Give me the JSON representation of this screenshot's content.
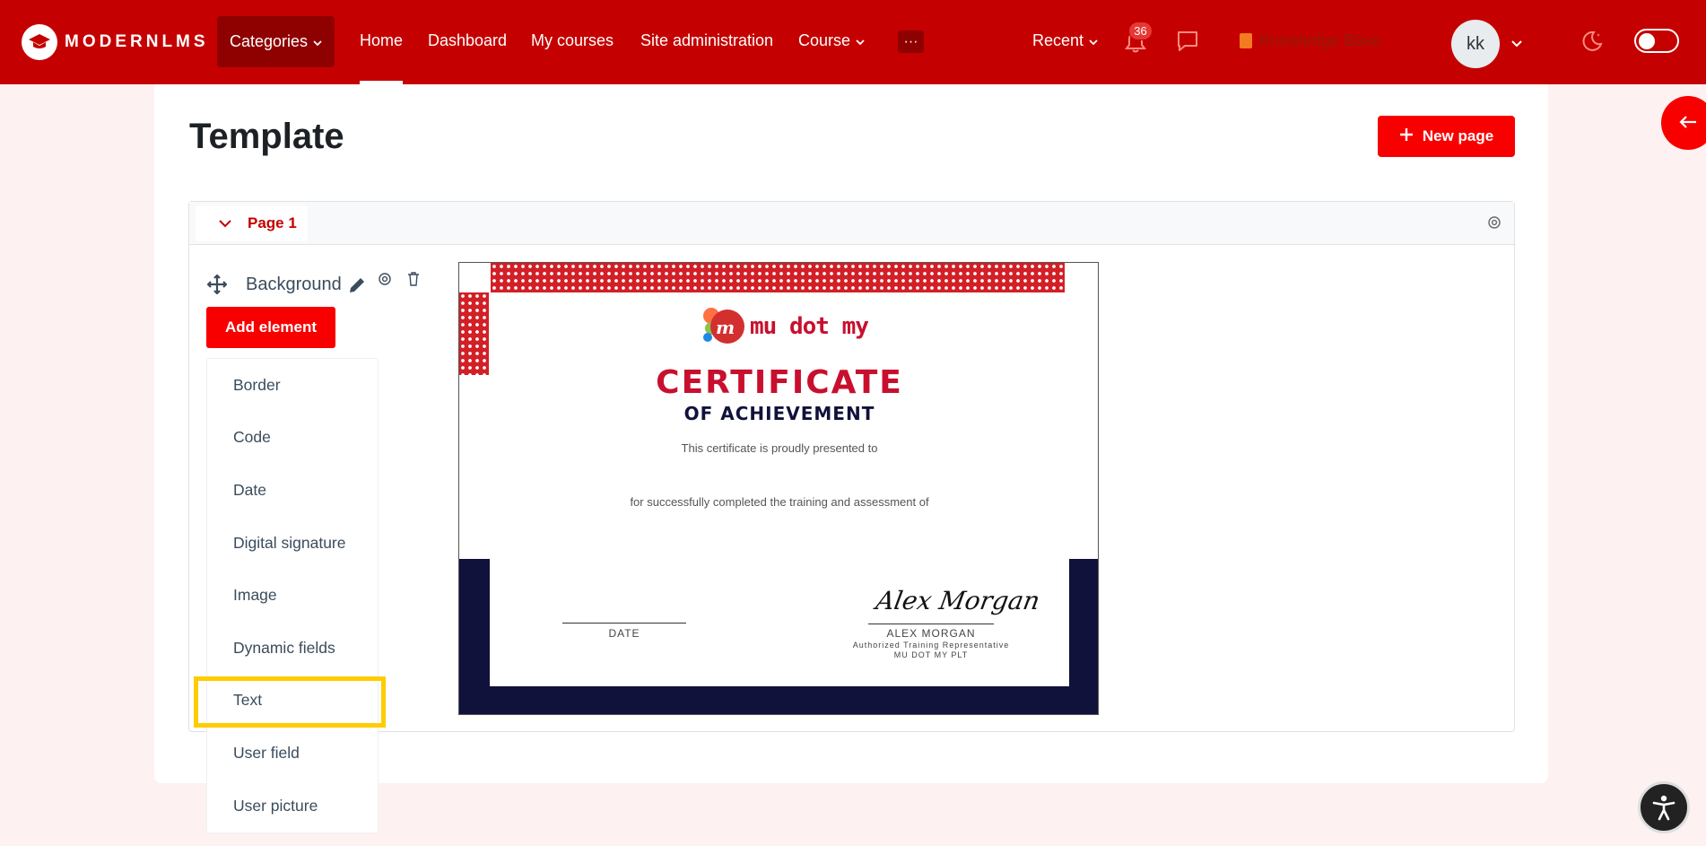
{
  "brand": {
    "name": "MODERNLMS"
  },
  "nav": {
    "categories": "Categories",
    "home": "Home",
    "dashboard": "Dashboard",
    "my_courses": "My courses",
    "site_admin": "Site administration",
    "course": "Course",
    "more": "···",
    "recent": "Recent",
    "notification_count": "36",
    "knowledge_base": "Knowledge Base",
    "avatar_initials": "kk"
  },
  "main": {
    "title": "Template",
    "new_page_label": "New page",
    "page_tab": "Page 1",
    "background_label": "Background",
    "add_element_label": "Add element",
    "element_options": [
      "Border",
      "Code",
      "Date",
      "Digital signature",
      "Image",
      "Dynamic fields",
      "Text",
      "User field",
      "User picture"
    ],
    "highlighted_option": "Text"
  },
  "certificate": {
    "brand": "mu dot my",
    "title": "CERTIFICATE",
    "subtitle": "OF ACHIEVEMENT",
    "presented": "This certificate is proudly presented to",
    "completed": "for successfully completed the training and assessment of",
    "date_label": "DATE",
    "signature": "Alex Morgan",
    "signer_name": "ALEX MORGAN",
    "signer_role": "Authorized Training Representative",
    "signer_org": "MU DOT MY PLT"
  },
  "colors": {
    "brand_red": "#c50000",
    "button_red": "#f90000",
    "navy": "#10123b",
    "highlight": "#ffcc00"
  }
}
